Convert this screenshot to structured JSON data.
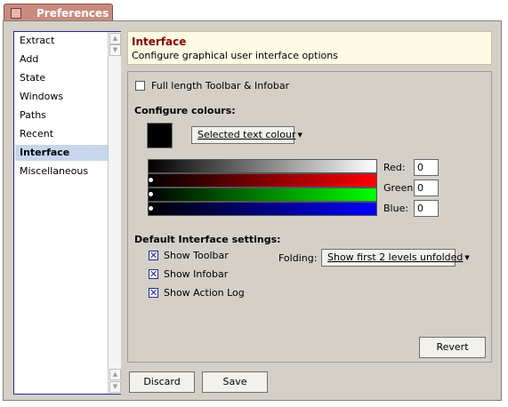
{
  "window": {
    "title": "Preferences"
  },
  "sidebar": {
    "items": [
      {
        "label": "Extract"
      },
      {
        "label": "Add"
      },
      {
        "label": "State"
      },
      {
        "label": "Windows"
      },
      {
        "label": "Paths"
      },
      {
        "label": "Recent"
      },
      {
        "label": "Interface",
        "selected": true
      },
      {
        "label": "Miscellaneous"
      }
    ]
  },
  "header": {
    "title": "Interface",
    "subtitle": "Configure graphical user interface options"
  },
  "toolbar_option": {
    "label": "Full length Toolbar & Infobar",
    "checked": false
  },
  "colours": {
    "heading": "Configure colours",
    "selector_label": "Selected text colour",
    "swatch_color": "#000000",
    "red_label": "Red:",
    "red_value": "0",
    "green_label": "Green:",
    "green_value": "0",
    "blue_label": "Blue:",
    "blue_value": "0"
  },
  "defaults": {
    "heading": "Default Interface settings:",
    "show_toolbar": {
      "label": "Show Toolbar",
      "checked": true
    },
    "show_infobar": {
      "label": "Show Infobar",
      "checked": true
    },
    "show_action_log": {
      "label": "Show Action Log",
      "checked": true
    },
    "folding_label": "Folding:",
    "folding_value": "Show first 2 levels unfolded"
  },
  "buttons": {
    "revert": "Revert",
    "discard": "Discard",
    "save": "Save"
  },
  "theme": {
    "accent": "#c98a80",
    "selection": "#c7d6ec",
    "header_title": "#8a0000"
  }
}
